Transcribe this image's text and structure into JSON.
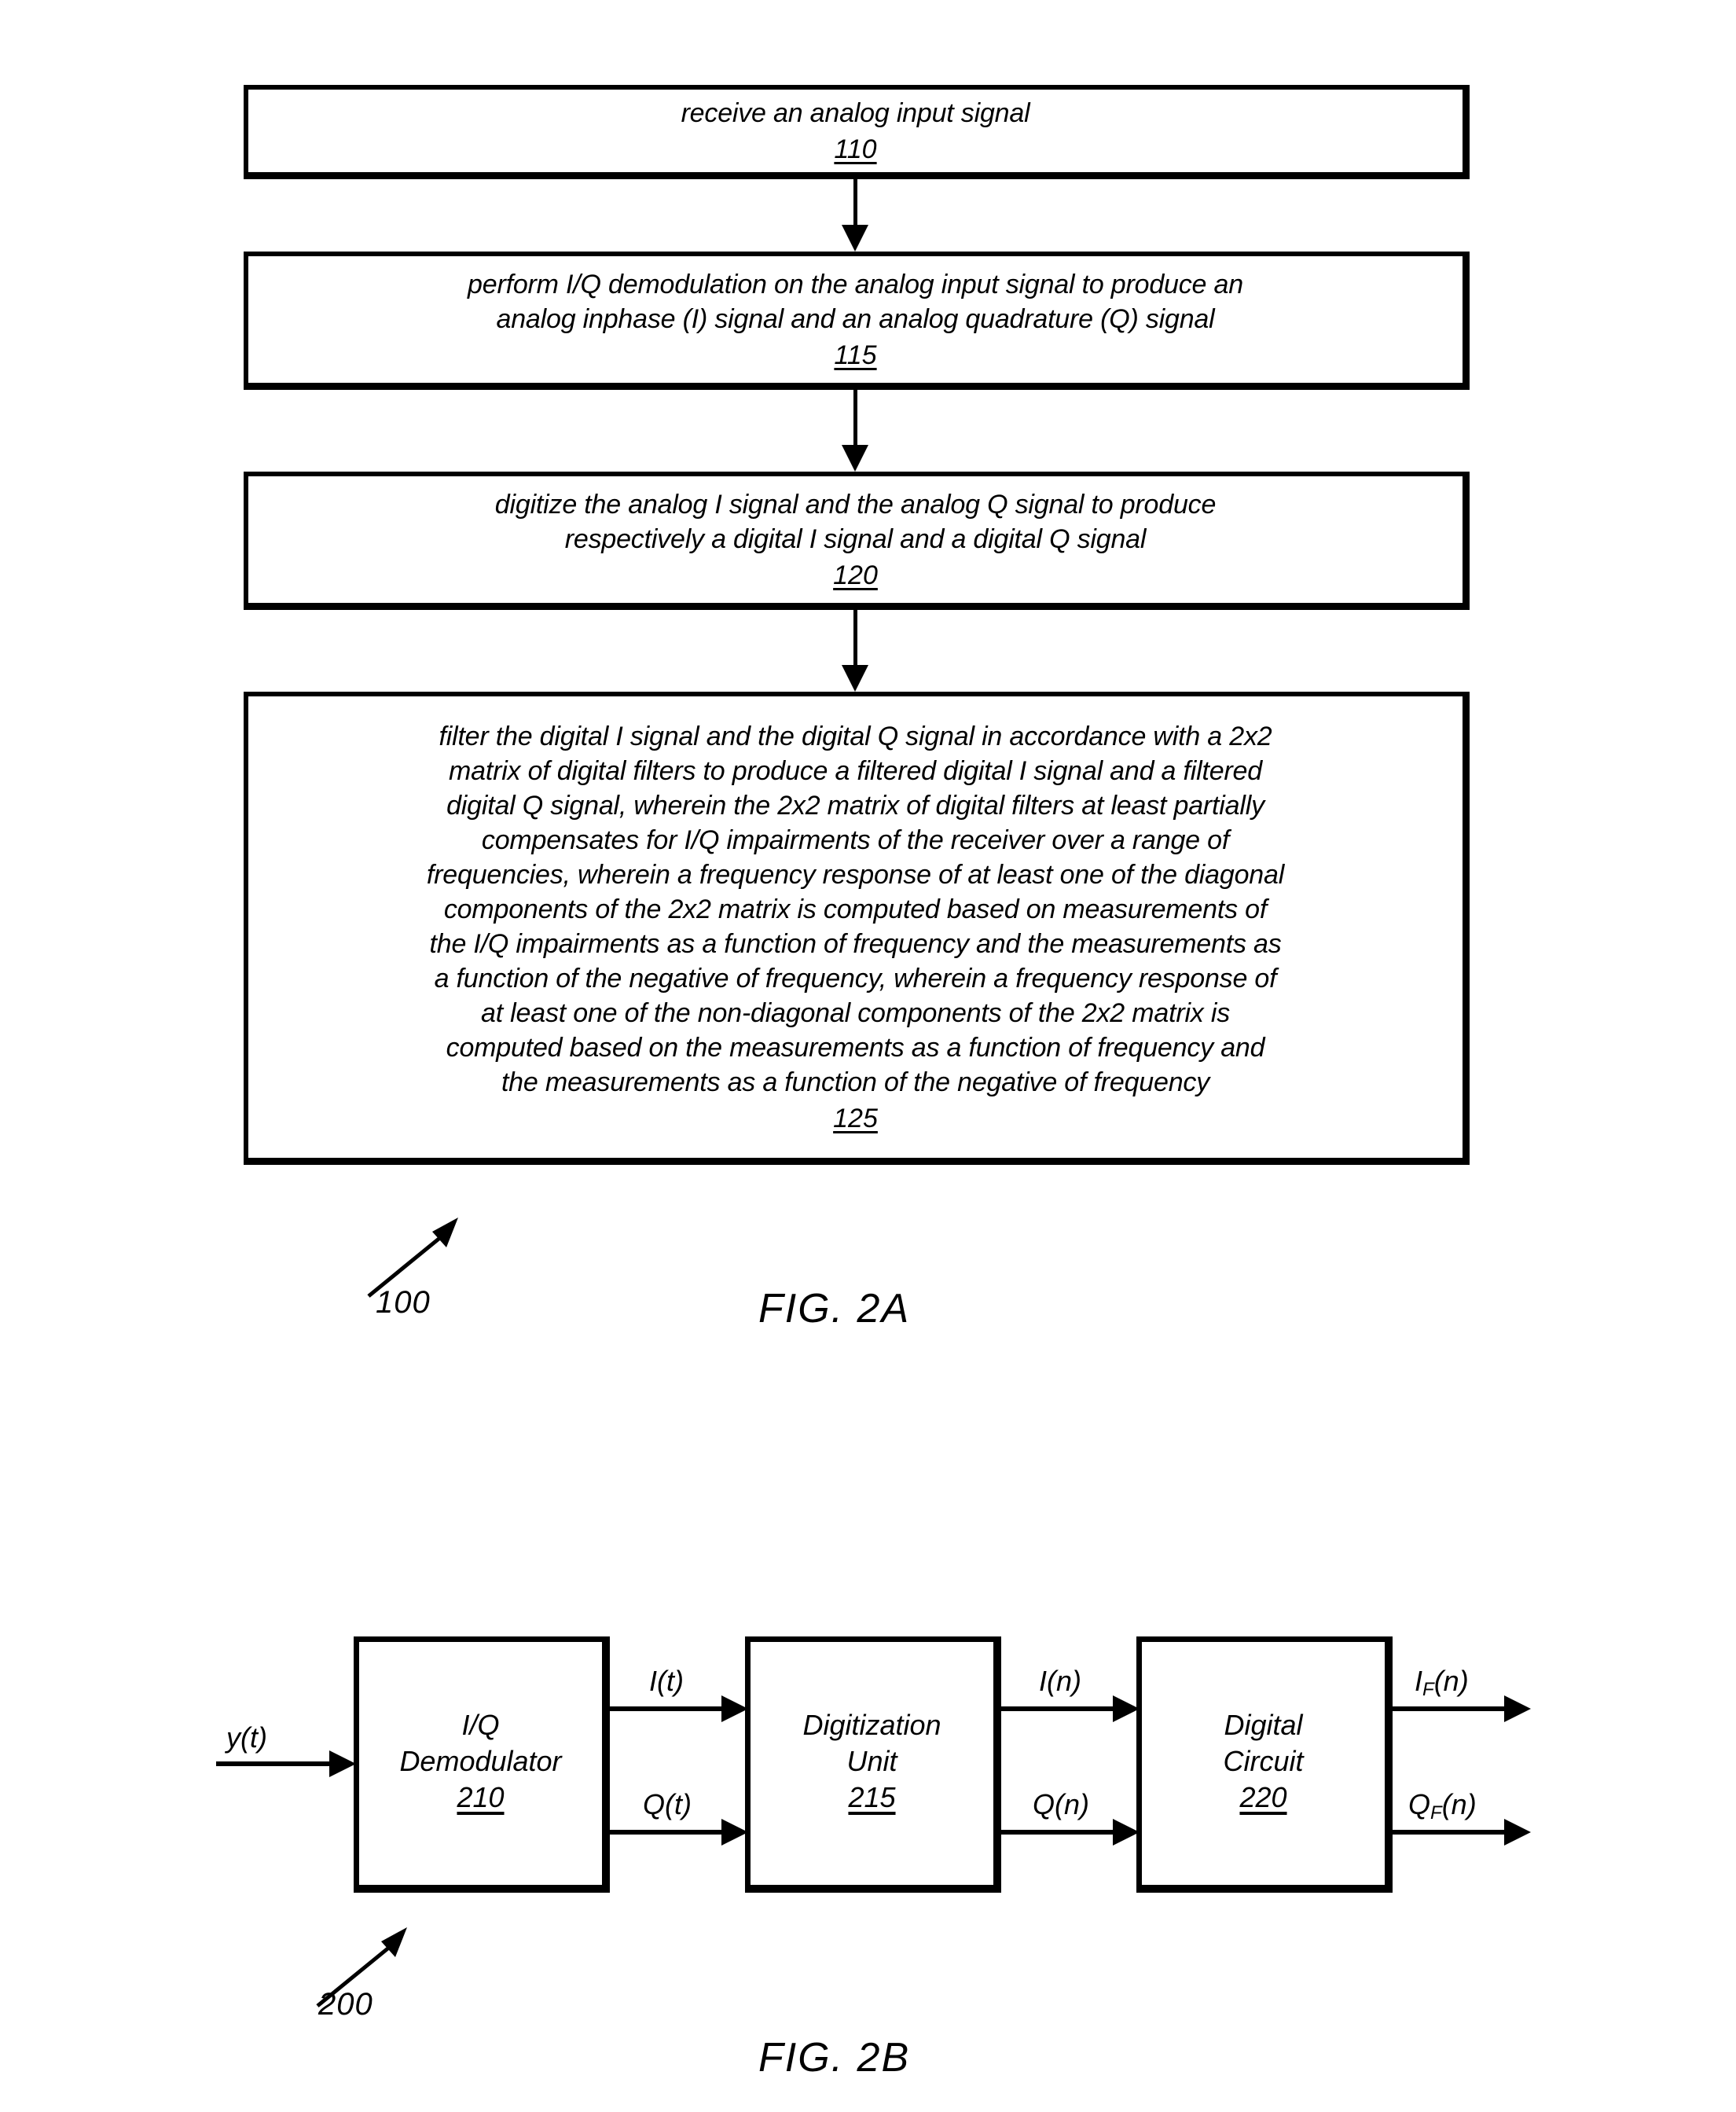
{
  "figure_2a": {
    "caption": "FIG. 2A",
    "reference_numeral": "100",
    "steps": [
      {
        "text": "receive an analog input signal",
        "number": "110"
      },
      {
        "text": "perform I/Q demodulation on the analog input signal to produce an\nanalog inphase (I) signal and an analog quadrature (Q) signal",
        "number": "115"
      },
      {
        "text": "digitize the analog I signal and the analog Q signal to produce\nrespectively a digital I signal and a digital Q signal",
        "number": "120"
      },
      {
        "text": "filter the digital I signal and the digital Q signal in accordance with a 2x2\nmatrix of digital filters to produce a filtered digital I signal and a filtered\ndigital Q signal, wherein the 2x2 matrix of digital filters at least partially\ncompensates for I/Q impairments of the receiver over a range of\nfrequencies, wherein a frequency response of at least one of the diagonal\ncomponents of the 2x2 matrix  is computed based on measurements of\nthe I/Q impairments as a function of frequency and the measurements as\na function of the negative of frequency, wherein a frequency response of\nat least one of the non-diagonal components of the 2x2 matrix is\ncomputed based on the measurements as a function of frequency and\nthe measurements as a function of the negative of frequency",
        "number": "125"
      }
    ]
  },
  "figure_2b": {
    "caption": "FIG. 2B",
    "reference_numeral": "200",
    "input_label": "y(t)",
    "blocks": [
      {
        "text": "I/Q\nDemodulator",
        "number": "210"
      },
      {
        "text": "Digitization\nUnit",
        "number": "215"
      },
      {
        "text": "Digital\nCircuit",
        "number": "220"
      }
    ],
    "signals": {
      "i_analog": "I(t)",
      "q_analog": "Q(t)",
      "i_digital": "I(n)",
      "q_digital": "Q(n)",
      "i_filtered_base": "I",
      "i_filtered_sub": "F",
      "i_filtered_tail": "(n)",
      "q_filtered_base": "Q",
      "q_filtered_sub": "F",
      "q_filtered_tail": "(n)"
    }
  },
  "colors": {
    "ink": "#000000",
    "paper": "#ffffff"
  }
}
